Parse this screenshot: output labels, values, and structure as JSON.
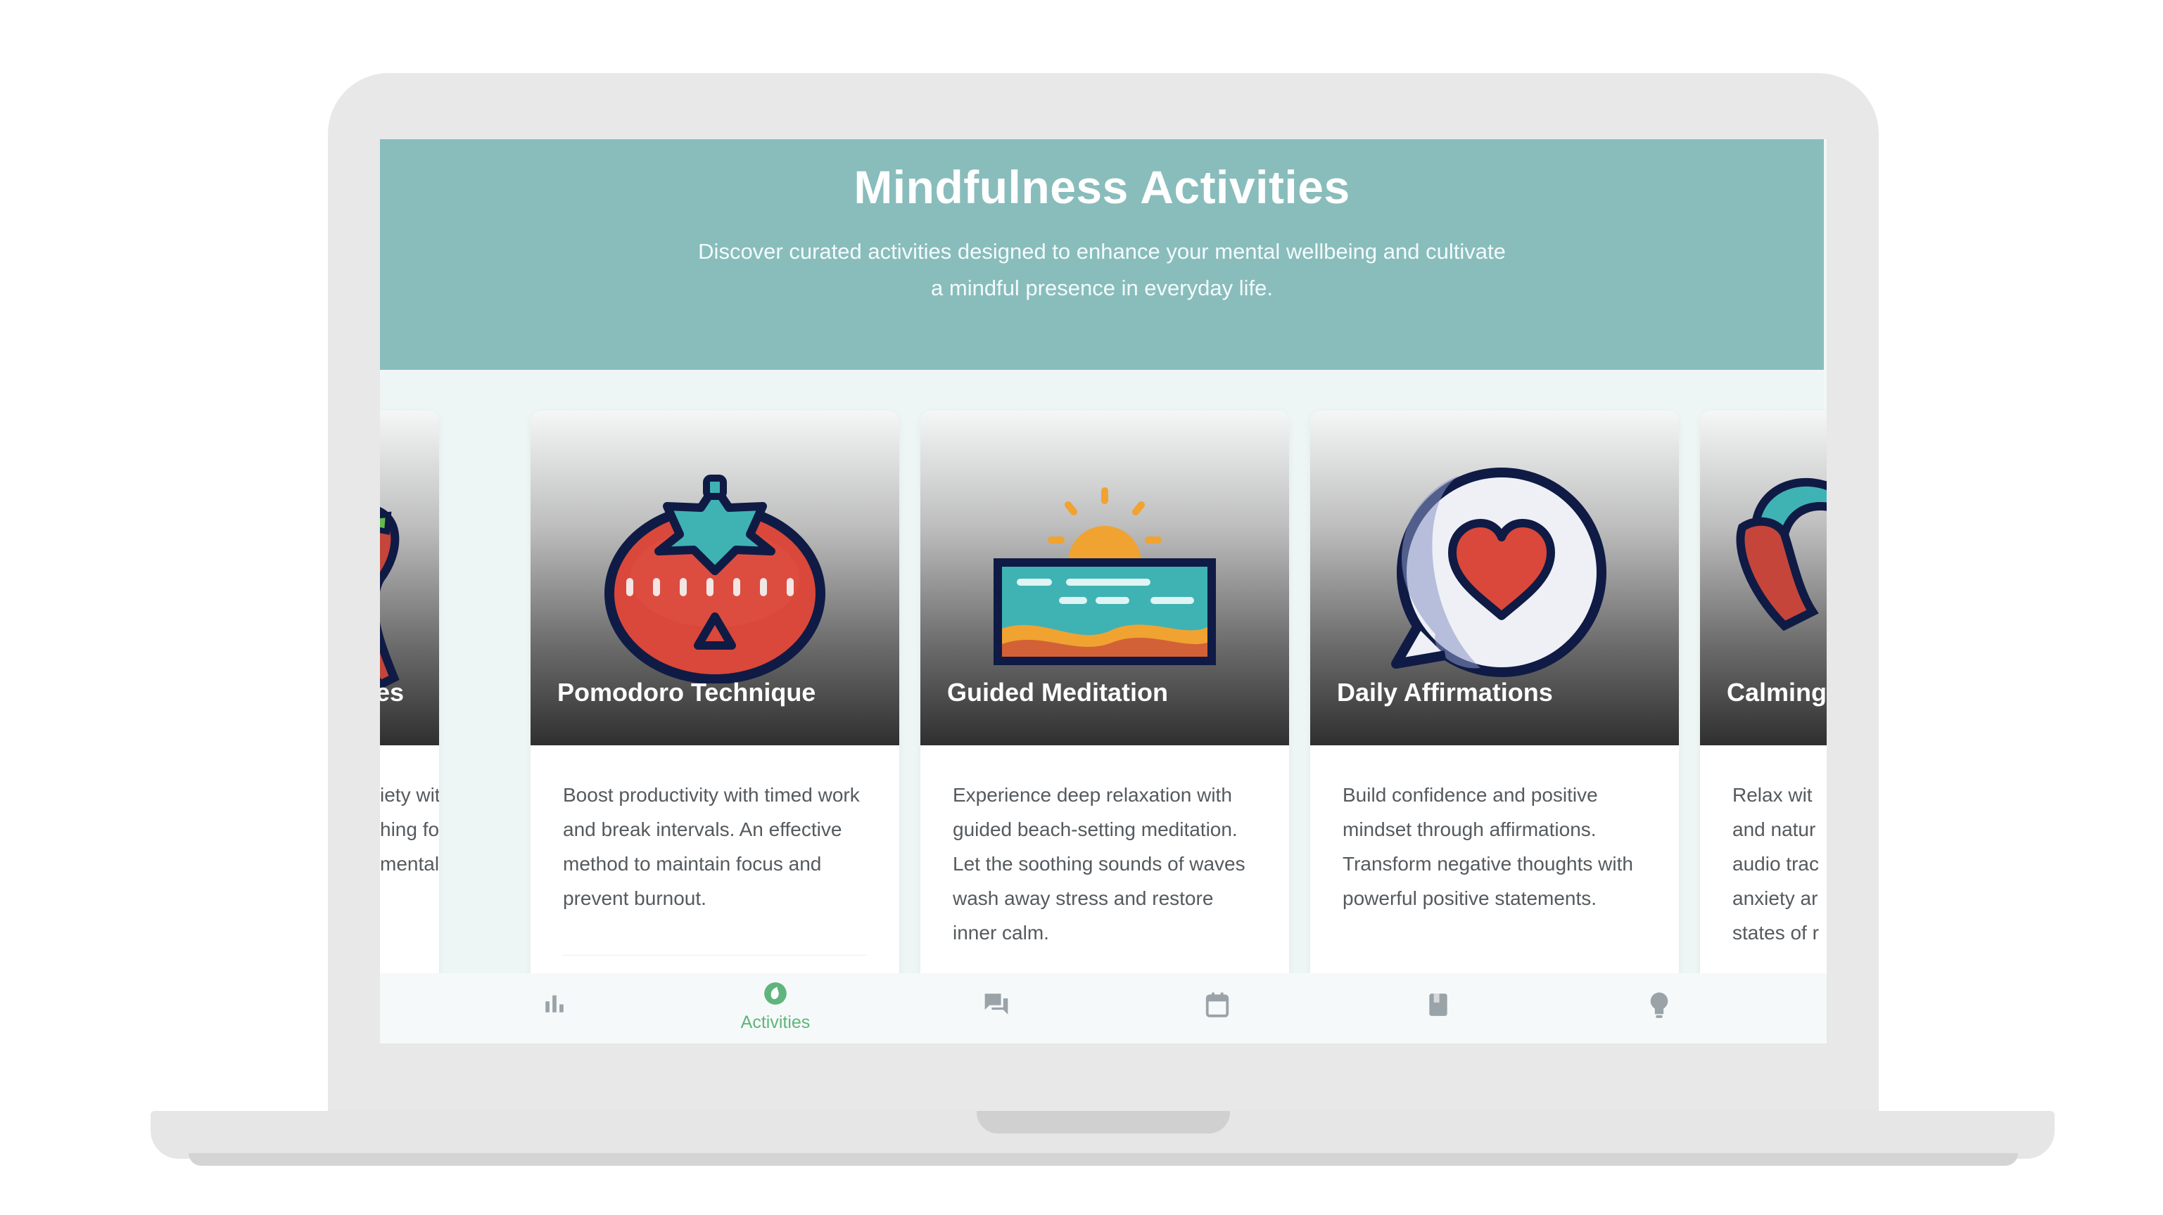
{
  "header": {
    "title": "Mindfulness Activities",
    "subtitle": "Discover curated activities designed to enhance your mental wellbeing and cultivate a mindful presence in everyday life."
  },
  "cards": [
    {
      "title": "es",
      "description": "iety with niques. hing for nd mental",
      "icon": "partial-icon"
    },
    {
      "title": "Pomodoro Technique",
      "description": "Boost productivity with timed work and break intervals. An effective method to maintain focus and prevent burnout.",
      "icon": "tomato-timer-icon"
    },
    {
      "title": "Guided Meditation",
      "description": "Experience deep relaxation with guided beach-setting meditation. Let the soothing sounds of waves wash away stress and restore inner calm.",
      "icon": "sunset-beach-icon"
    },
    {
      "title": "Daily Affirmations",
      "description": "Build confidence and positive mindset through affirmations. Transform negative thoughts with powerful positive statements.",
      "icon": "heart-speech-bubble-icon"
    },
    {
      "title": "Calming",
      "description": "Relax wit and natur audio trac anxiety ar states of r",
      "icon": "headphones-icon"
    }
  ],
  "nav": {
    "items": [
      {
        "label": "",
        "icon": "bar-chart-icon",
        "active": false
      },
      {
        "label": "Activities",
        "icon": "activities-icon",
        "active": true
      },
      {
        "label": "",
        "icon": "chat-icon",
        "active": false
      },
      {
        "label": "",
        "icon": "calendar-icon",
        "active": false
      },
      {
        "label": "",
        "icon": "book-icon",
        "active": false
      },
      {
        "label": "",
        "icon": "lightbulb-icon",
        "active": false
      }
    ]
  },
  "colors": {
    "header_bg": "#88bdbc",
    "accent": "#5fb57c",
    "icon_dark": "#0f1b45",
    "tomato": "#d9483a",
    "teal": "#3fb2b4"
  }
}
